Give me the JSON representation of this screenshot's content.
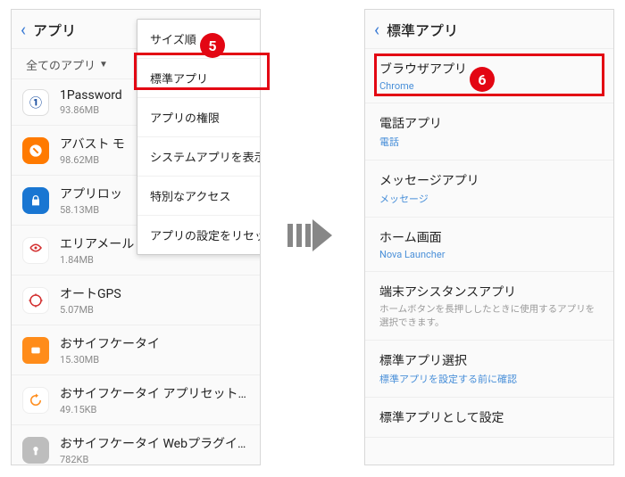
{
  "left": {
    "header_title": "アプリ",
    "filter_label": "全てのアプリ",
    "apps": [
      {
        "name": "1Password",
        "size": "93.86MB"
      },
      {
        "name": "アバスト モ",
        "size": "98.62MB"
      },
      {
        "name": "アプリロッ",
        "size": "58.13MB"
      },
      {
        "name": "エリアメール",
        "size": "1.84MB"
      },
      {
        "name": "オートGPS",
        "size": "5.07MB"
      },
      {
        "name": "おサイフケータイ",
        "size": "15.30MB"
      },
      {
        "name": "おサイフケータイ アプリセットアップ",
        "size": "49.15KB"
      },
      {
        "name": "おサイフケータイ Webプラグイン",
        "size": "782KB"
      }
    ],
    "menu": [
      "サイズ順",
      "標準アプリ",
      "アプリの権限",
      "システムアプリを表示",
      "特別なアクセス",
      "アプリの設定をリセット"
    ]
  },
  "right": {
    "header_title": "標準アプリ",
    "items": [
      {
        "title": "ブラウザアプリ",
        "sub": "Chrome",
        "sub_color": "blue"
      },
      {
        "title": "電話アプリ",
        "sub": "電話",
        "sub_color": "blue"
      },
      {
        "title": "メッセージアプリ",
        "sub": "メッセージ",
        "sub_color": "blue"
      },
      {
        "title": "ホーム画面",
        "sub": "Nova Launcher",
        "sub_color": "blue"
      },
      {
        "title": "端末アシスタンスアプリ",
        "sub": "ホームボタンを長押ししたときに使用するアプリを選択できます。",
        "sub_color": "grey"
      },
      {
        "title": "標準アプリ選択",
        "sub": "標準アプリを設定する前に確認",
        "sub_color": "blue"
      },
      {
        "title": "標準アプリとして設定",
        "sub": "",
        "sub_color": "none"
      }
    ]
  },
  "badges": {
    "five": "5",
    "six": "6"
  }
}
